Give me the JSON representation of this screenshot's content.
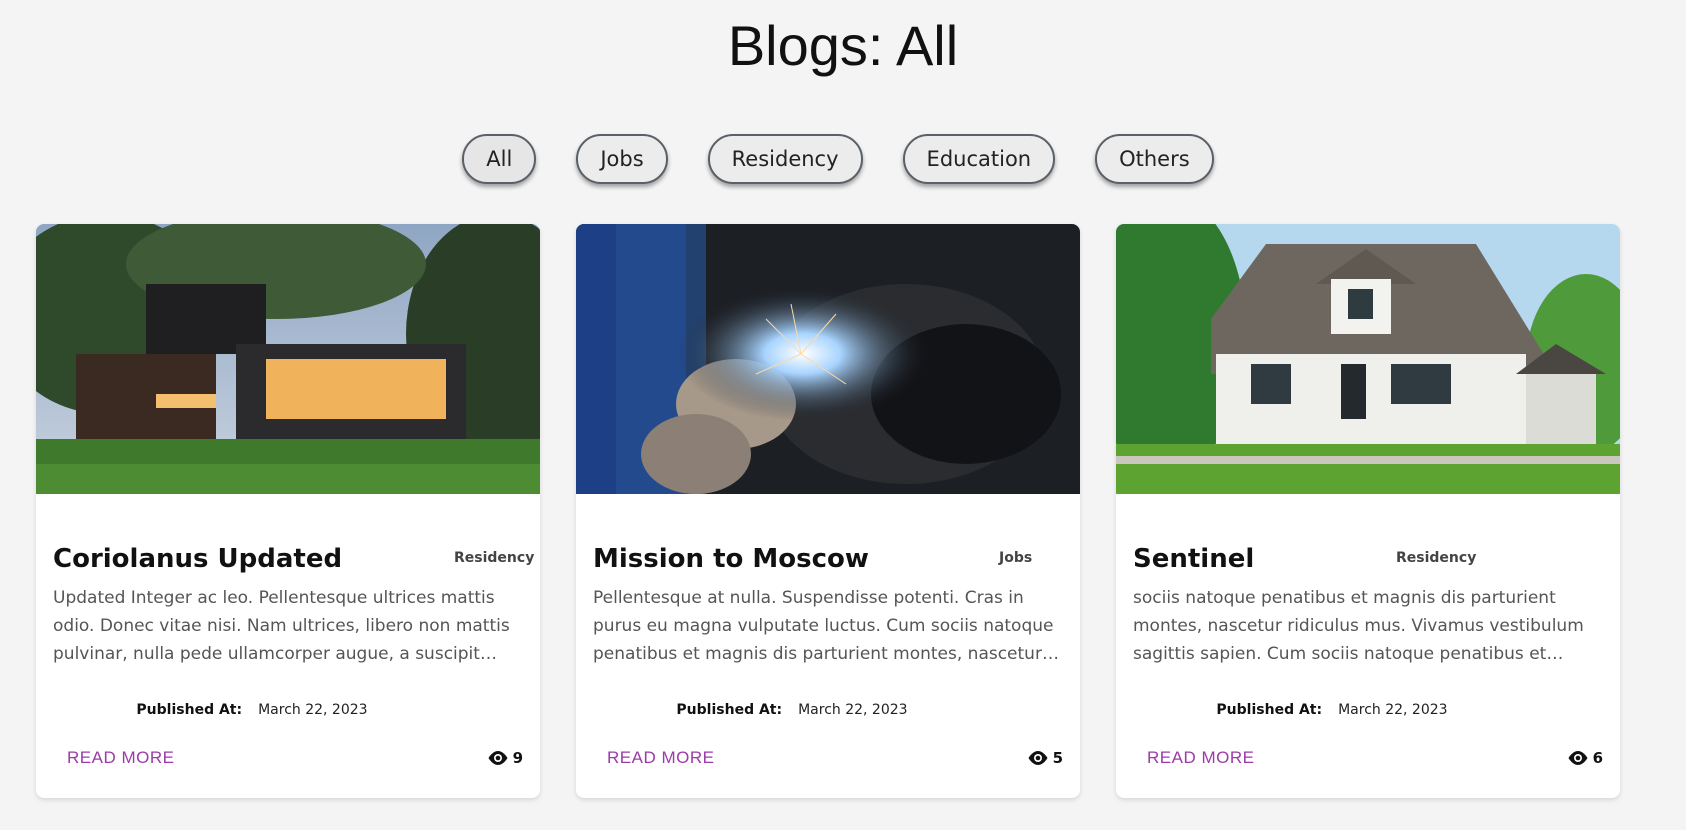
{
  "page": {
    "title": "Blogs: All"
  },
  "filters": [
    {
      "label": "All",
      "active": true
    },
    {
      "label": "Jobs",
      "active": false
    },
    {
      "label": "Residency",
      "active": false
    },
    {
      "label": "Education",
      "active": false
    },
    {
      "label": "Others",
      "active": false
    }
  ],
  "cards": [
    {
      "title": "Coriolanus Updated",
      "category": "Residency",
      "excerpt": "Updated Integer ac leo. Pellentesque ultrices mattis odio. Donec vitae nisi. Nam ultrices, libero non mattis pulvinar, nulla pede ullamcorper augue, a suscipit nulla elit ac nulla.",
      "published_label": "Published At:",
      "published_date": "March 22, 2023",
      "read_more": "READ MORE",
      "views": "9",
      "image": "modern-house-at-dusk"
    },
    {
      "title": "Mission to Moscow",
      "category": "Jobs",
      "excerpt": "Pellentesque at nulla. Suspendisse potenti. Cras in purus eu magna vulputate luctus. Cum sociis natoque penatibus et magnis dis parturient montes, nascetur ridiculus mus.",
      "published_label": "Published At:",
      "published_date": "March 22, 2023",
      "read_more": "READ MORE",
      "views": "5",
      "image": "welder-with-sparks"
    },
    {
      "title": "Sentinel",
      "category": "Residency",
      "excerpt": "sociis natoque penatibus et magnis dis parturient montes, nascetur ridiculus mus. Vivamus vestibulum sagittis sapien. Cum sociis natoque penatibus et magnis dis parturient montes.",
      "published_label": "Published At:",
      "published_date": "March 22, 2023",
      "read_more": "READ MORE",
      "views": "6",
      "image": "white-suburban-house"
    }
  ],
  "colors": {
    "background": "#f4f4f4",
    "accent_link": "#9c3aa8",
    "card": "#ffffff"
  },
  "icons": {
    "views": "eye-icon"
  }
}
